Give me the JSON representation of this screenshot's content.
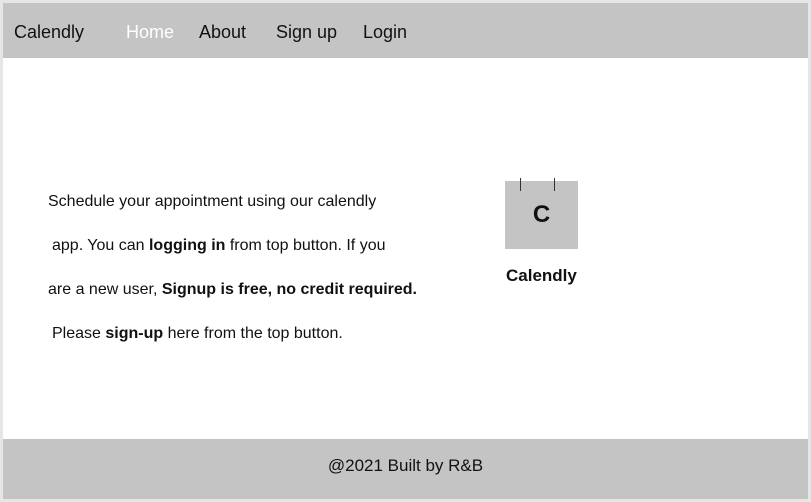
{
  "navbar": {
    "brand": "Calendly",
    "links": [
      {
        "label": "Home",
        "active": true
      },
      {
        "label": "About"
      },
      {
        "label": "Sign up"
      },
      {
        "label": "Login"
      }
    ]
  },
  "intro": {
    "line1": "Schedule your appointment using our calendly",
    "line2_pre": "app. You can ",
    "line2_bold": "logging in",
    "line2_post": " from top button. If you",
    "line3_pre": "are a new user, ",
    "line3_bold": "Signup is free, no credit required.",
    "line4_pre": "Please ",
    "line4_bold": "sign-up",
    "line4_post": " here from the top button."
  },
  "logo": {
    "letter": "C",
    "caption": "Calendly"
  },
  "footer": {
    "text": "@2021 Built by R&B"
  },
  "colors": {
    "bar_background": "#c4c4c4",
    "active_link": "#ffffff",
    "page_background": "#ffffff"
  }
}
